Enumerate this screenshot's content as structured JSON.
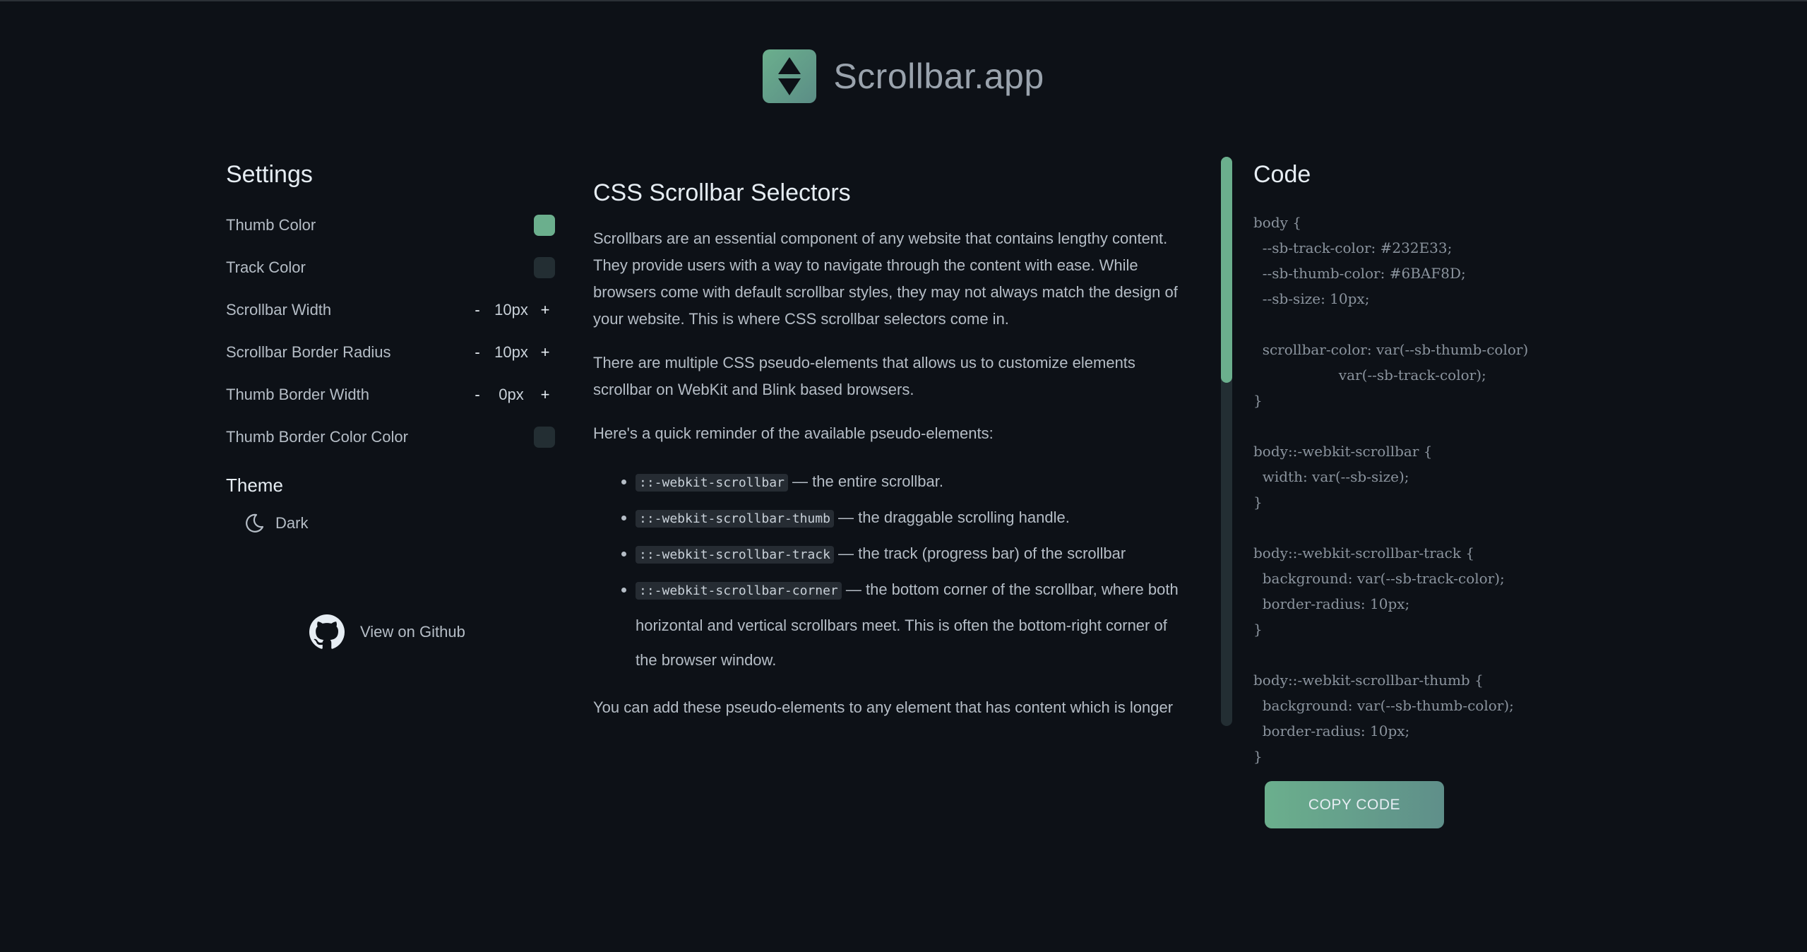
{
  "app": {
    "title": "Scrollbar.app",
    "accent": "#6BAF8D"
  },
  "settings": {
    "title": "Settings",
    "thumb_color": {
      "label": "Thumb Color",
      "color": "#6BAF8D"
    },
    "track_color": {
      "label": "Track Color",
      "color": "#232E33"
    },
    "scrollbar_width": {
      "label": "Scrollbar Width",
      "value": "10px",
      "minus": "-",
      "plus": "+"
    },
    "border_radius": {
      "label": "Scrollbar Border Radius",
      "value": "10px",
      "minus": "-",
      "plus": "+"
    },
    "thumb_border_width": {
      "label": "Thumb Border Width",
      "value": "0px",
      "minus": "-",
      "plus": "+"
    },
    "thumb_border_color": {
      "label": "Thumb Border Color Color",
      "color": "#232E33"
    },
    "theme": {
      "title": "Theme",
      "option": "Dark",
      "icon": "moon-icon"
    },
    "github": {
      "label": "View on Github",
      "icon": "github-icon"
    }
  },
  "article": {
    "title": "CSS Scrollbar Selectors",
    "p1": "Scrollbars are an essential component of any website that contains lengthy content. They provide users with a way to navigate through the content with ease. While browsers come with default scrollbar styles, they may not always match the design of your website. This is where CSS scrollbar selectors come in.",
    "p2": "There are multiple CSS pseudo-elements that allows us to customize elements scrollbar on WebKit and Blink based browsers.",
    "p3": "Here's a quick reminder of the available pseudo-elements:",
    "items": [
      {
        "code": "::-webkit-scrollbar",
        "text": " — the entire scrollbar."
      },
      {
        "code": "::-webkit-scrollbar-thumb",
        "text": " — the draggable scrolling handle."
      },
      {
        "code": "::-webkit-scrollbar-track",
        "text": " — the track (progress bar) of the scrollbar"
      },
      {
        "code": "::-webkit-scrollbar-corner",
        "text": " — the bottom corner of the scrollbar, where both horizontal and vertical scrollbars meet. This is often the bottom-right corner of the browser window."
      }
    ],
    "p4": "You can add these pseudo-elements to any element that has content which is longer"
  },
  "code": {
    "title": "Code",
    "text": "body {\n  --sb-track-color: #232E33;\n  --sb-thumb-color: #6BAF8D;\n  --sb-size: 10px;\n\n  scrollbar-color: var(--sb-thumb-color)\n                   var(--sb-track-color);\n}\n\nbody::-webkit-scrollbar {\n  width: var(--sb-size);\n}\n\nbody::-webkit-scrollbar-track {\n  background: var(--sb-track-color);\n  border-radius: 10px;\n}\n\nbody::-webkit-scrollbar-thumb {\n  background: var(--sb-thumb-color);\n  border-radius: 10px;\n}",
    "copy_label": "COPY CODE"
  }
}
